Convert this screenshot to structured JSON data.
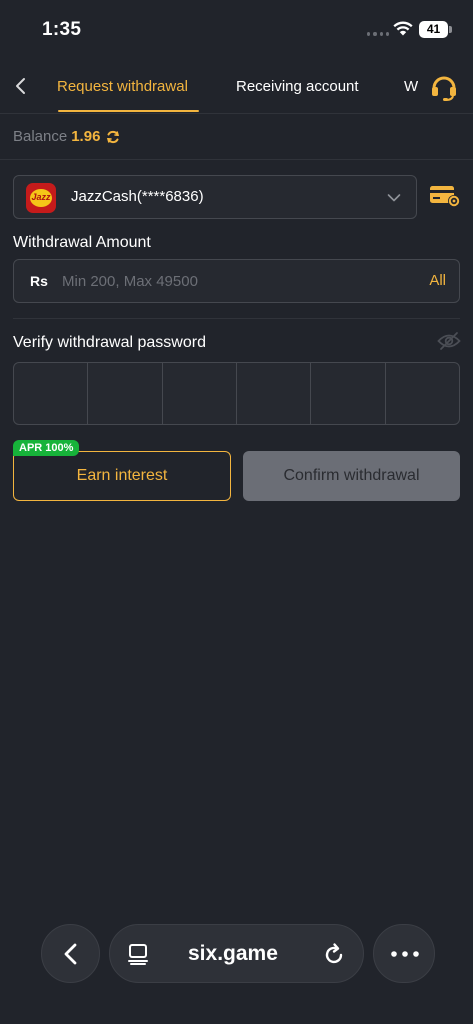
{
  "status": {
    "time": "1:35",
    "battery": "41"
  },
  "tabs": [
    {
      "label": "Request withdrawal",
      "active": true
    },
    {
      "label": "Receiving account",
      "active": false
    },
    {
      "label": "W",
      "active": false
    }
  ],
  "balance": {
    "label": "Balance",
    "value": "1.96"
  },
  "account": {
    "name": "JazzCash(****6836)",
    "logo_text": "Jazz"
  },
  "amount": {
    "label": "Withdrawal Amount",
    "currency": "Rs",
    "placeholder": "Min 200, Max 49500",
    "value": "",
    "all_label": "All"
  },
  "password": {
    "label": "Verify withdrawal password",
    "digits": 6
  },
  "buttons": {
    "earn": "Earn interest",
    "apr_badge": "APR 100%",
    "confirm": "Confirm withdrawal"
  },
  "browser": {
    "url": "six.game"
  },
  "colors": {
    "accent": "#f3b53f",
    "background": "#21242b",
    "badge": "#17b33a"
  }
}
